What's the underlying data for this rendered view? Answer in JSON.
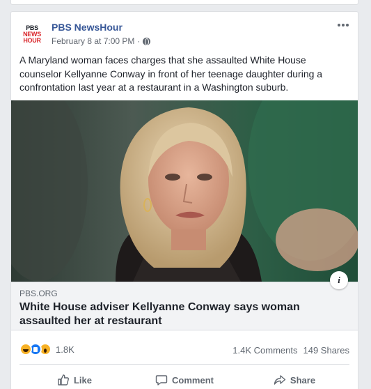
{
  "post": {
    "page_name": "PBS NewsHour",
    "logo": {
      "line1": "PBS",
      "line2": "NEWS",
      "line3": "HOUR"
    },
    "timestamp": "February 8 at 7:00 PM",
    "separator": "·",
    "privacy_icon": "globe-icon",
    "text": "A Maryland woman faces charges that she assaulted White House counselor Kellyanne Conway in front of her teenage daughter during a confrontation last year at a restaurant in a Washington suburb."
  },
  "link": {
    "source": "PBS.ORG",
    "headline": "White House adviser Kellyanne Conway says woman assaulted her at restaurant",
    "info_label": "i"
  },
  "stats": {
    "reaction_icons": [
      "haha-icon",
      "like-icon",
      "wow-icon"
    ],
    "reactions": "1.8K",
    "comments": "1.4K Comments",
    "shares": "149 Shares"
  },
  "actions": {
    "like": "Like",
    "comment": "Comment",
    "share": "Share"
  },
  "colors": {
    "brand_link": "#385898",
    "pbs_red": "#d9252a",
    "muted_text": "#606770",
    "background": "#e9ebee"
  }
}
